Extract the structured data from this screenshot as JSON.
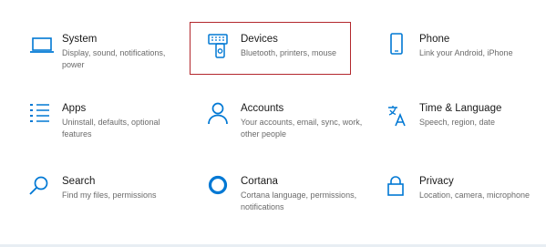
{
  "colors": {
    "accent": "#0078d4",
    "highlight": "#b3282d"
  },
  "tiles": [
    {
      "title": "System",
      "description": "Display, sound, notifications, power",
      "icon": "laptop-icon"
    },
    {
      "title": "Devices",
      "description": "Bluetooth, printers, mouse",
      "icon": "devices-icon"
    },
    {
      "title": "Phone",
      "description": "Link your Android, iPhone",
      "icon": "phone-icon"
    },
    {
      "title": "Apps",
      "description": "Uninstall, defaults, optional features",
      "icon": "apps-list-icon"
    },
    {
      "title": "Accounts",
      "description": "Your accounts, email, sync, work, other people",
      "icon": "person-icon"
    },
    {
      "title": "Time & Language",
      "description": "Speech, region, date",
      "icon": "time-language-icon"
    },
    {
      "title": "Search",
      "description": "Find my files, permissions",
      "icon": "search-icon"
    },
    {
      "title": "Cortana",
      "description": "Cortana language, permissions, notifications",
      "icon": "cortana-icon"
    },
    {
      "title": "Privacy",
      "description": "Location, camera, microphone",
      "icon": "lock-icon"
    }
  ]
}
